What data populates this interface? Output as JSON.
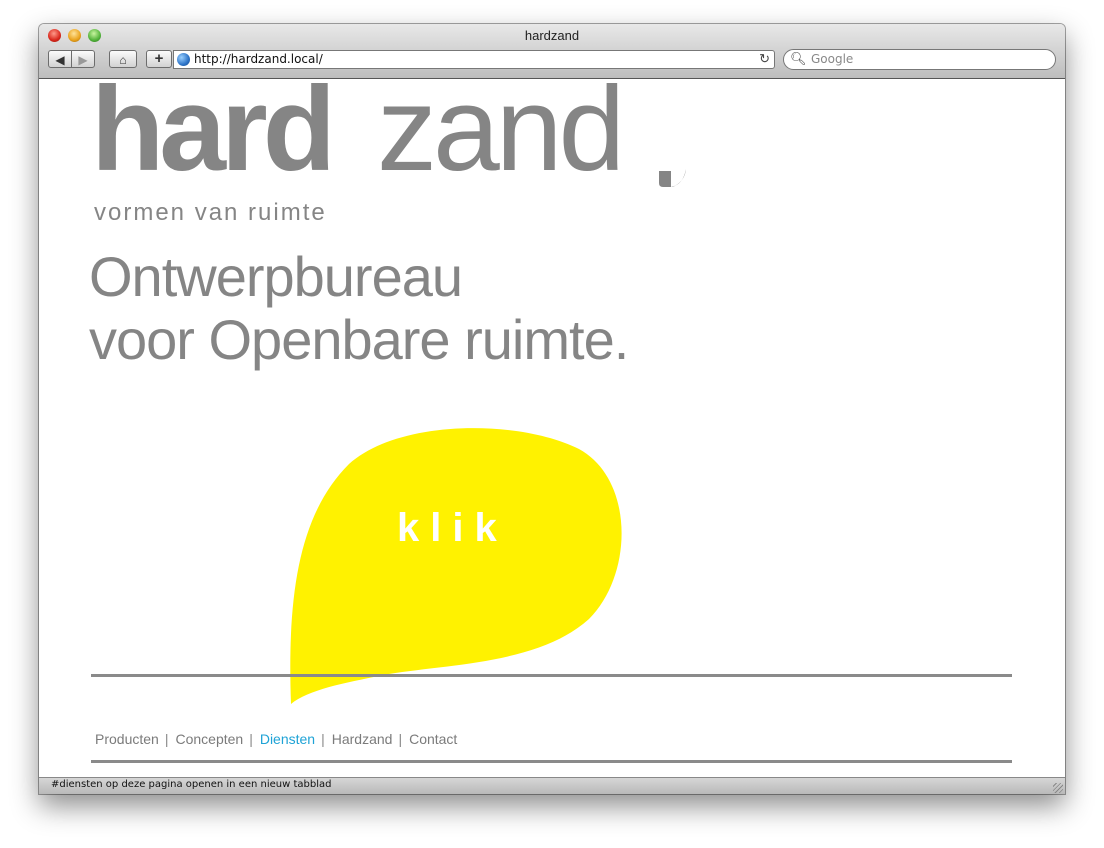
{
  "window": {
    "title": "hardzand"
  },
  "toolbar": {
    "back_icon": "back-arrow-icon",
    "forward_icon": "forward-arrow-icon",
    "home_icon": "home-icon",
    "add_icon": "plus-icon",
    "url": "http://hardzand.local/",
    "search_placeholder": "Google"
  },
  "page": {
    "logo_bold": "hard",
    "logo_light": "zand",
    "tagline": "vormen van ruimte",
    "headline_line1": "Ontwerpbureau",
    "headline_line2": "voor Openbare ruimte.",
    "cta": "klik",
    "nav": [
      {
        "label": "Producten",
        "active": false
      },
      {
        "label": "Concepten",
        "active": false
      },
      {
        "label": "Diensten",
        "active": true
      },
      {
        "label": "Hardzand",
        "active": false
      },
      {
        "label": "Contact",
        "active": false
      }
    ]
  },
  "statusbar": {
    "text": "#diensten op deze pagina openen in een nieuw tabblad"
  },
  "colors": {
    "logo_gray": "#858585",
    "accent_yellow": "#fff200",
    "active_link": "#1fa3d6",
    "rule": "#8a8a8a"
  }
}
